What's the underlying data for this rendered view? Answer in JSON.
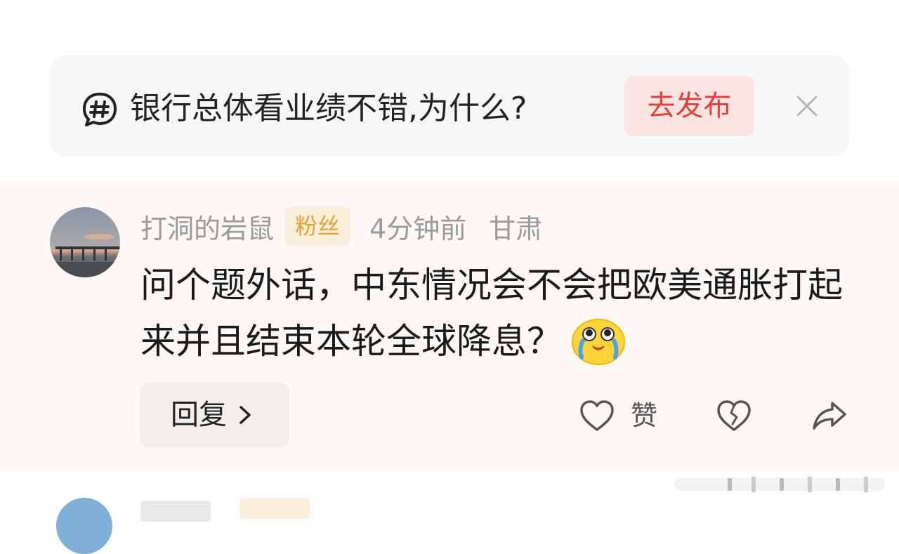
{
  "topic": {
    "icon": "hashtag-bubble-icon",
    "title": "银行总体看业绩不错,为什么?",
    "publish_label": "去发布",
    "close_icon": "close-icon"
  },
  "comment": {
    "username": "打洞的岩鼠",
    "badge": "粉丝",
    "time": "4分钟前",
    "location": "甘肃",
    "text": "问个题外话，中东情况会不会把欧美通胀打起来并且结束本轮全球降息？",
    "emoji": "crying-emoji",
    "reply_label": "回复",
    "like_label": "赞",
    "icons": [
      "heart-icon",
      "broken-heart-icon",
      "share-icon"
    ]
  },
  "colors": {
    "accent_red": "#e0413a",
    "publish_bg": "#fbe4e2",
    "badge_text": "#e6a137",
    "badge_bg": "#fbefdc",
    "comment_bg": "#fbf8f5"
  }
}
